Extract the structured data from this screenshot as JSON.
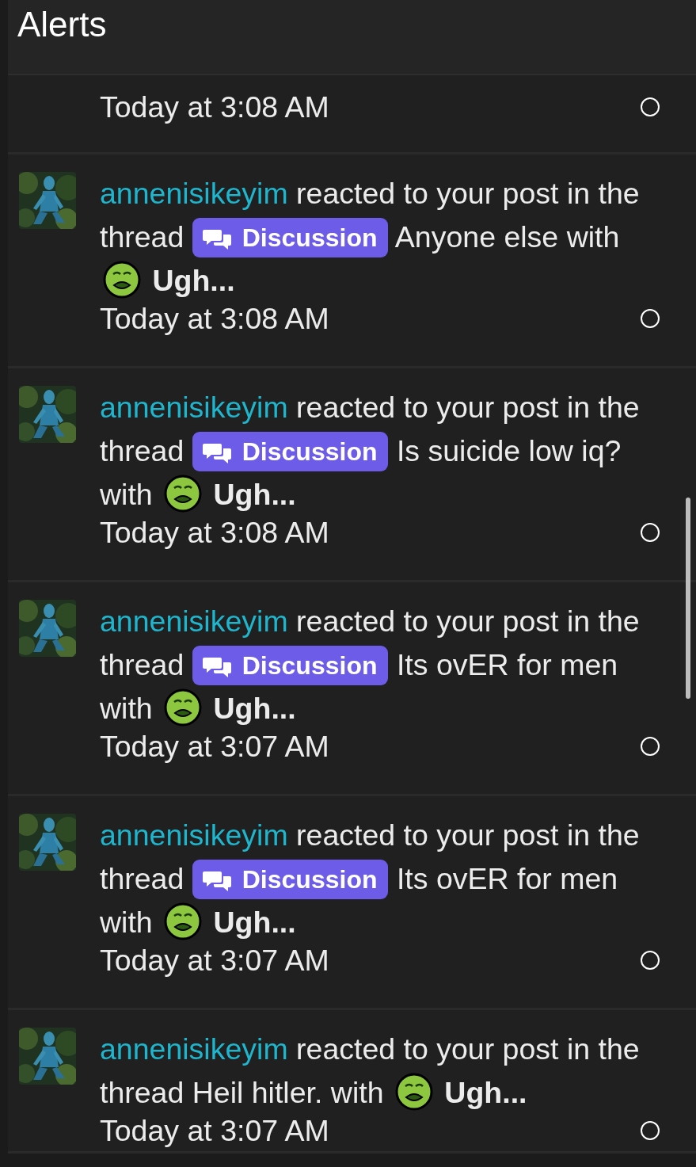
{
  "header": {
    "title": "Alerts"
  },
  "alerts": [
    {
      "kind": "partial",
      "time": "Today at 3:08 AM"
    },
    {
      "kind": "full",
      "user": "annenisikeyim",
      "action": "reacted to your post in the thread",
      "prefix": "Discussion",
      "thread": "Anyone else",
      "joiner": "with",
      "reaction": "Ugh...",
      "time": "Today at 3:08 AM"
    },
    {
      "kind": "full",
      "user": "annenisikeyim",
      "action": "reacted to your post in the thread",
      "prefix": "Discussion",
      "thread": "Is suicide low iq?",
      "joiner": "with",
      "reaction": "Ugh...",
      "time": "Today at 3:08 AM"
    },
    {
      "kind": "full",
      "user": "annenisikeyim",
      "action": "reacted to your post in the thread",
      "prefix": "Discussion",
      "thread": "Its ovER for men",
      "joiner": "with",
      "reaction": "Ugh...",
      "time": "Today at 3:07 AM"
    },
    {
      "kind": "full",
      "user": "annenisikeyim",
      "action": "reacted to your post in the thread",
      "prefix": "Discussion",
      "thread": "Its ovER for men",
      "joiner": "with",
      "reaction": "Ugh...",
      "time": "Today at 3:07 AM"
    },
    {
      "kind": "cut",
      "user": "annenisikeyim",
      "action": "reacted to your post in the thread",
      "thread": "Heil hitler.",
      "joiner": "with",
      "reaction": "Ugh...",
      "time": "Today at 3:07 AM"
    }
  ]
}
